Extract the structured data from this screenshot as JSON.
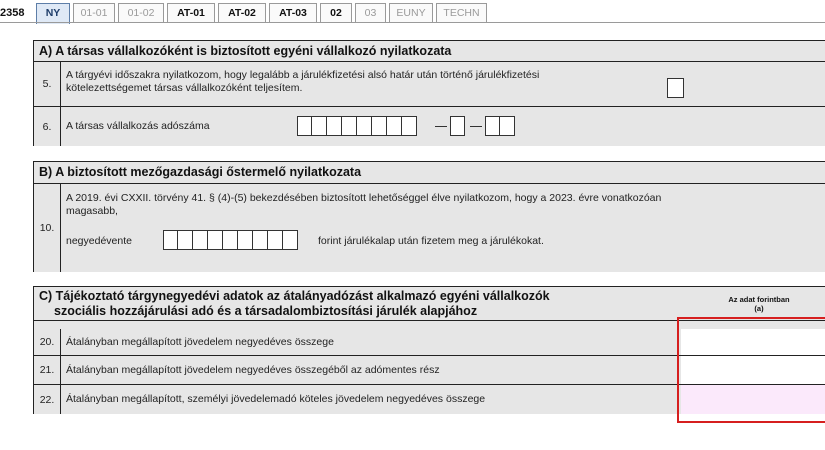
{
  "tabbar": {
    "doc_id": "2358",
    "tabs": [
      {
        "label": "NY",
        "state": "active"
      },
      {
        "label": "01-01",
        "state": "dim"
      },
      {
        "label": "01-02",
        "state": "dim"
      },
      {
        "label": "AT-01",
        "state": "bold"
      },
      {
        "label": "AT-02",
        "state": "bold"
      },
      {
        "label": "AT-03",
        "state": "bold"
      },
      {
        "label": "02",
        "state": "bold"
      },
      {
        "label": "03",
        "state": "dim"
      },
      {
        "label": "EUNY",
        "state": "dim"
      },
      {
        "label": "TECHN",
        "state": "dim"
      }
    ]
  },
  "section_a": {
    "title": "A) A társas vállalkozóként is biztosított egyéni vállalkozó nyilatkozata",
    "rows": [
      {
        "num": "5.",
        "text_line1": "A tárgyévi időszakra nyilatkozom, hogy legalább a járulékfizetési alsó határ után történő járulékfizetési",
        "text_line2": "kötelezettségemet társas vállalkozóként teljesítem."
      },
      {
        "num": "6.",
        "text_line1": "A társas vállalkozás adószáma"
      }
    ]
  },
  "section_b": {
    "title": "B) A biztosított mezőgazdasági őstermelő nyilatkozata",
    "row": {
      "num": "10.",
      "text_line1": "A 2019. évi CXXII. törvény 41. § (4)-(5) bekezdésében biztosított lehetőséggel élve nyilatkozom, hogy a 2023. évre vonatkozóan",
      "text_line2": "magasabb,",
      "field_prefix": "negyedévente",
      "field_suffix": "forint járulékalap után fizetem meg a járulékokat."
    }
  },
  "section_c": {
    "title_line1": "C) Tájékoztató tárgynegyedévi adatok az átalányadózást alkalmazó egyéni vállalkozók",
    "title_line2": "szociális hozzájárulási adó és a társadalombiztosítási járulék alapjához",
    "col_header_line1": "Az adat forintban",
    "col_header_line2": "(a)",
    "rows": [
      {
        "num": "20.",
        "text": "Átalányban megállapított jövedelem negyedéves összege",
        "value": ""
      },
      {
        "num": "21.",
        "text": "Átalányban megállapított jövedelem negyedéves összegéből az adómentes rész",
        "value": ""
      },
      {
        "num": "22.",
        "text": "Átalányban megállapított, személyi jövedelemadó köteles jövedelem negyedéves összege",
        "value": ""
      }
    ]
  },
  "colors": {
    "section_bg": "#e6e6e6",
    "active_tab_bg": "#dfe9f6",
    "selection_border": "#d61f1f",
    "pink_cell": "#fbe9fb"
  }
}
